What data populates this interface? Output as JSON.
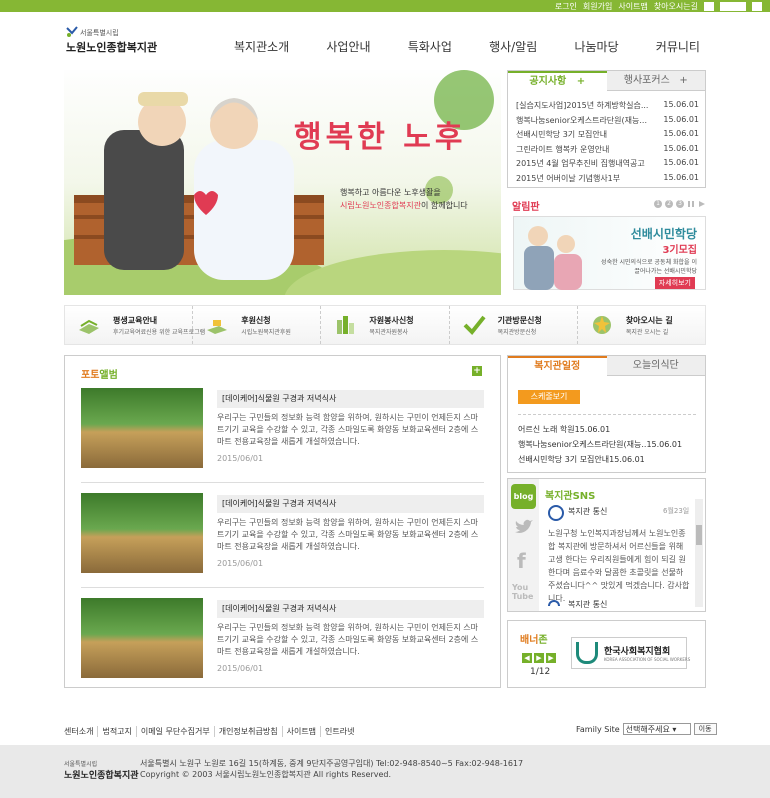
{
  "top_links": {
    "login": "로그인",
    "join": "회원가입",
    "sitemap": "사이트맵",
    "directions": "찾아오시는길",
    "zoom_in": "+",
    "zoom": "100%",
    "zoom_out": "−"
  },
  "logo": {
    "small": "서울특별시립",
    "name": "노원노인종합복지관"
  },
  "nav": [
    "복지관소개",
    "사업안내",
    "특화사업",
    "행사/알림",
    "나눔마당",
    "커뮤니티"
  ],
  "hero": {
    "title": "행복한 노후",
    "line1": "행복하고 아름다운 노후생활을",
    "line2_highlight": "시립노원노인종합복지관",
    "line2_rest": "이 함께합니다"
  },
  "notice": {
    "tab_active": "공지사항",
    "tab_active_plus": "+",
    "tab_other": "행사포커스",
    "tab_other_plus": "+",
    "items": [
      {
        "title": "[실습지도사업]2015년 하계방학실습...",
        "date": "15.06.01"
      },
      {
        "title": "행복나눔senior오케스트라단원(재능...",
        "date": "15.06.01"
      },
      {
        "title": "선배시민학당 3기 모집안내",
        "date": "15.06.01"
      },
      {
        "title": "그린라이트 행복카 운영안내",
        "date": "15.06.01"
      },
      {
        "title": "2015년 4월 업무추진비 집행내역공고",
        "date": "15.06.01"
      },
      {
        "title": "2015년 어버이날 기념행사1부",
        "date": "15.06.01"
      }
    ]
  },
  "alim": {
    "heading": "알림판",
    "pages": [
      "1",
      "2",
      "3"
    ],
    "banner_title": "선배시민학당",
    "banner_sub": "3기모집",
    "banner_desc": "성숙한 시민의식으로 공동체 화합을 이끌어나가는 선배시민학당",
    "banner_btn": "자세히보기"
  },
  "quick": [
    {
      "title": "평생교육안내",
      "sub": "후기교육여료신용 위한 교육프로그램"
    },
    {
      "title": "후원신청",
      "sub": "시립노원복지관후원"
    },
    {
      "title": "자원봉사신청",
      "sub": "복지관자원봉사"
    },
    {
      "title": "기관방문신청",
      "sub": "복지관방문신청"
    },
    {
      "title": "찾아오시는 길",
      "sub": "복지관 오시는 길"
    }
  ],
  "photo": {
    "heading_a": "포토",
    "heading_b": "앨범",
    "plus": "+",
    "items": [
      {
        "caption": "[데이케어]식물원 구경과 저녁식사",
        "text": "우리구는 구민들의 정보화 능력 함양을 위하여, 원하시는 구민이 언제든지 스마트기기 교육을 수강할 수 있고, 각종 스마일도록 화양동 보화교육센터 2층에 스마트 전용교육장을 새롭게 개설하였습니다.",
        "date": "2015/06/01"
      },
      {
        "caption": "[데이케어]식물원 구경과 저녁식사",
        "text": "우리구는 구민들의 정보화 능력 함양을 위하여, 원하시는 구민이 언제든지 스마트기기 교육을 수강할 수 있고, 각종 스마일도록 화양동 보화교육센터 2층에 스마트 전용교육장을 새롭게 개설하였습니다.",
        "date": "2015/06/01"
      },
      {
        "caption": "[데이케어]식물원 구경과 저녁식사",
        "text": "우리구는 구민들의 정보화 능력 함양을 위하여, 원하시는 구민이 언제든지 스마트기기 교육을 수강할 수 있고, 각종 스마일도록 화양동 보화교육센터 2층에 스마트 전용교육장을 새롭게 개설하였습니다.",
        "date": "2015/06/01"
      }
    ]
  },
  "schedule": {
    "tab_active": "복지관일정",
    "tab_other": "오늘의식단",
    "button": "스케줄보기",
    "items": [
      "어르신 노래 학원15.06.01",
      "행복나눔senior오케스트라단원(재능..15.06.01",
      "선배시민학당 3기 모집안내15.06.01"
    ]
  },
  "sns": {
    "heading": "복지관SNS",
    "side": {
      "blog": "blog",
      "twitter": "𝕥",
      "facebook": "f",
      "youtube_1": "You",
      "youtube_2": "Tube"
    },
    "author": "복지관 통신",
    "date": "6월23일",
    "body": "노원구청 노인복지과장님께서 노원노인종합 복지관에 방문하셔서 어르신들을 위해 고생 한다는 우리직원들에게 힘이 되길 원한다며 음료수와 달콤한 초콜릿을 선물하주셨습니다^^ 맛있게 먹겠습니다. 감사합니다.",
    "author2": "복지관 통신"
  },
  "banner": {
    "heading_a": "배너",
    "heading_b": "존",
    "prev": "◀",
    "play": "▶",
    "next": "▶",
    "page": "1/12",
    "org_name": "한국사회복지협회",
    "org_en": "KOREA ASSOCIATION OF SOCIAL WORKERS"
  },
  "footer_links": [
    "센터소개",
    "법적고지",
    "이메일 무단수집거부",
    "개인정보취급방침",
    "사이트맵",
    "인트라넷"
  ],
  "family": {
    "label": "Family Site",
    "select": "선택해주세요",
    "go": "이동"
  },
  "footer": {
    "logo_small": "서울특별시립",
    "logo_name": "노원노인종합복지관",
    "address": "서울특별시 노원구 노원로 16길 15(하계동, 중계 9단지주공영구임대) Tel:02-948-8540~5 Fax:02-948-1617",
    "copyright": "Copyright © 2003 서울시립노원노인종합복지관 All rights Reserved."
  },
  "colors": {
    "accent_green": "#76b02a",
    "accent_orange": "#e07b1e",
    "accent_red": "#e03b53",
    "topbar": "#86b734"
  }
}
